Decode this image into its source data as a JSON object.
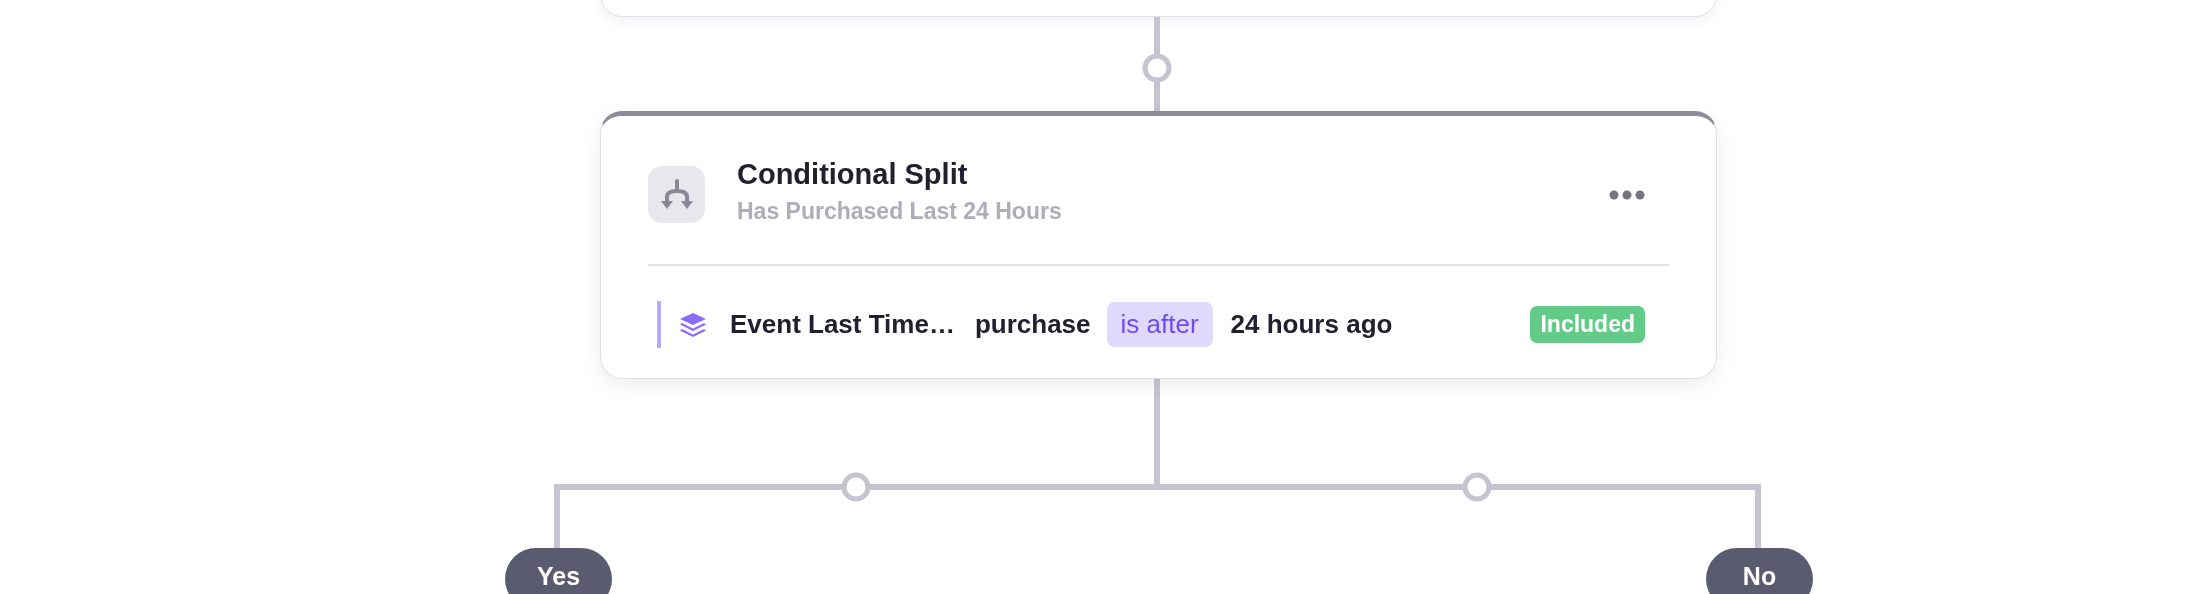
{
  "split_node": {
    "title": "Conditional Split",
    "subtitle": "Has Purchased Last 24 Hours",
    "condition": {
      "field": "Event Last Time…",
      "event": "purchase",
      "operator": "is after",
      "value": "24 hours ago",
      "status": "Included"
    }
  },
  "branches": [
    {
      "label": "Yes"
    },
    {
      "label": "No"
    }
  ]
}
